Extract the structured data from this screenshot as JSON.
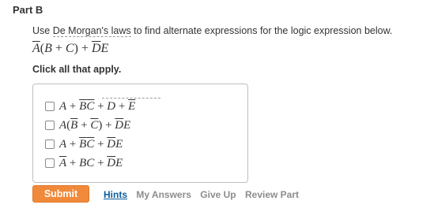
{
  "part": {
    "title": "Part B"
  },
  "instruction": {
    "prefix": "Use ",
    "laws": "De Morgan's laws",
    "suffix": " to find alternate expressions for the logic expression below."
  },
  "expression": "A(B + C) + DE",
  "prompt": "Click all that apply.",
  "options": [
    {
      "label": "A + BC + D + E",
      "checked": false
    },
    {
      "label": "A(B + C) + DE",
      "checked": false
    },
    {
      "label": "A + BC + DE",
      "checked": false
    },
    {
      "label": "A + BC + DE",
      "checked": false
    }
  ],
  "actions": {
    "submit": "Submit",
    "hints": "Hints",
    "my_answers": "My Answers",
    "give_up": "Give Up",
    "review_part": "Review Part"
  },
  "colors": {
    "submit_bg": "#f0893a",
    "link": "#0b5d9e",
    "disabled": "#8c8c8c"
  }
}
